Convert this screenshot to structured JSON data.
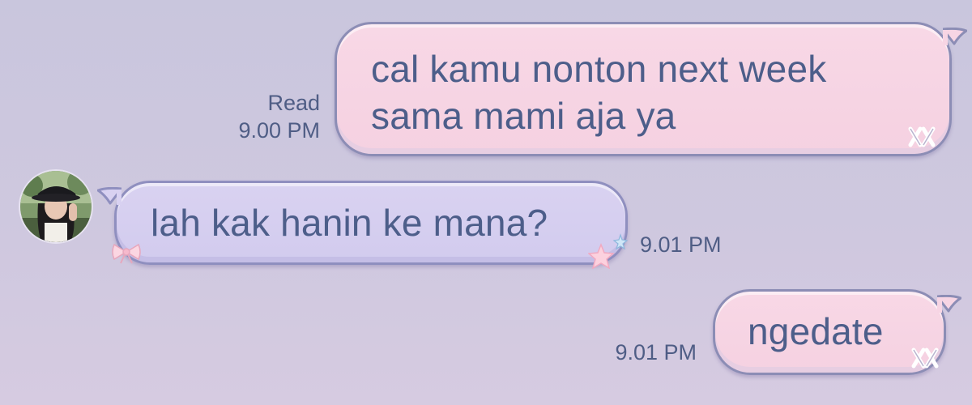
{
  "chat": {
    "messages": [
      {
        "direction": "outgoing",
        "lines": [
          "cal kamu nonton next week",
          "sama mami aja ya"
        ],
        "status": "Read",
        "time": "9.00 PM"
      },
      {
        "direction": "incoming",
        "text": "lah kak hanin ke mana?",
        "time": "9.01 PM"
      },
      {
        "direction": "outgoing",
        "text": "ngedate",
        "time": "9.01 PM"
      }
    ]
  },
  "colors": {
    "background": "#cbc7de",
    "outgoing_bubble": "#f6d3e3",
    "incoming_bubble": "#d6cff0",
    "bubble_border": "#8c8db5",
    "text": "#4d5e8a"
  },
  "icons": {
    "avatar": "contact-avatar",
    "outgoing_decoration": "crossed-bones-icon",
    "incoming_decoration_left": "bow-icon",
    "incoming_decoration_right": "stars-icon"
  }
}
